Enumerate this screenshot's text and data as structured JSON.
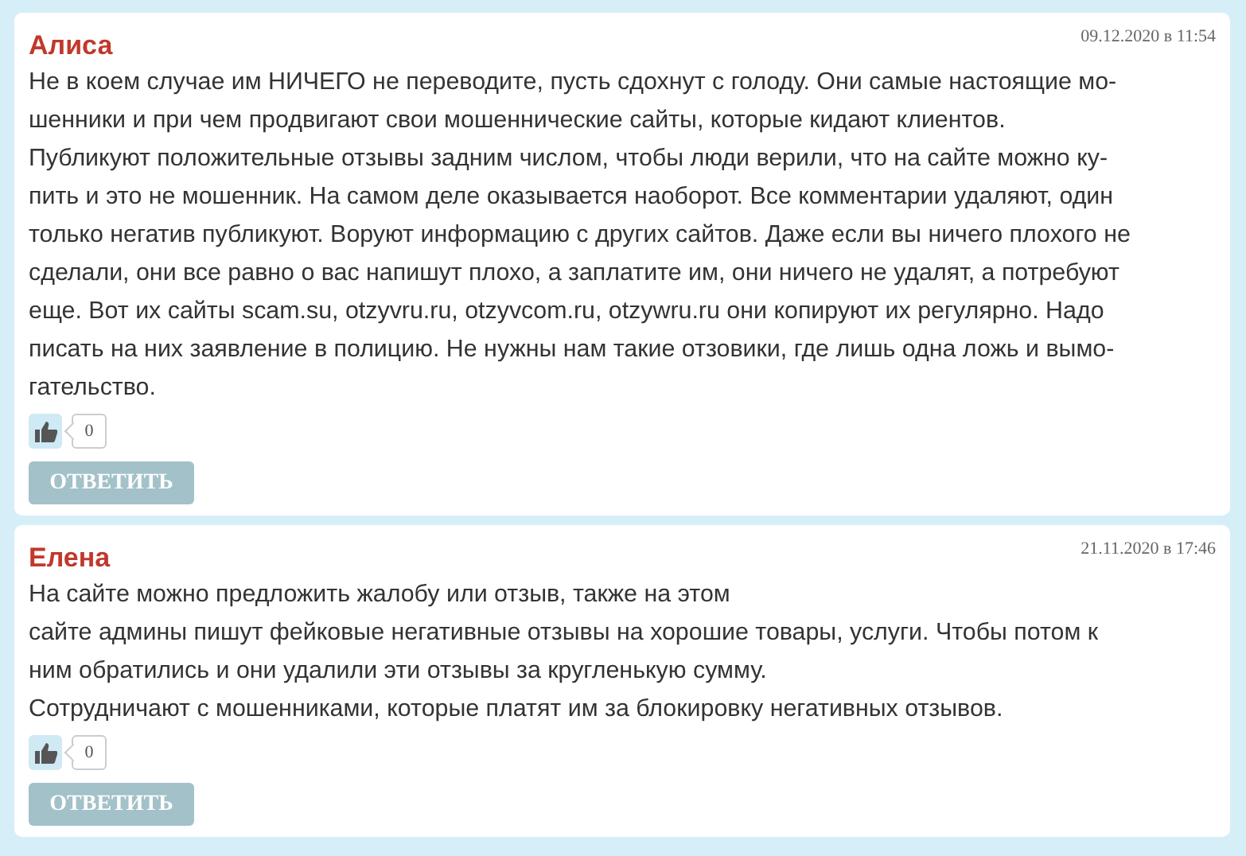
{
  "comments": [
    {
      "author": "Алиса",
      "date": "09.12.2020 в 11:54",
      "text": "Не в коем случае им НИЧЕГО не переводите, пусть сдохнут с голоду. Они самые настоящие мо-\nшенники и при чем продвигают свои мошеннические сайты, которые кидают клиентов.\nПубликуют положительные отзывы задним числом, чтобы люди верили, что на сайте можно ку-\nпить и это не мошенник. На самом деле оказывается наоборот. Все комментарии удаляют, один\nтолько негатив публикуют. Воруют информацию с других сайтов. Даже если вы ничего плохого не\nсделали, они все равно о вас напишут плохо, а заплатите им, они ничего не удалят, а потребуют\nеще. Вот их сайты scam.su, otzyvru.ru, otzyvcom.ru, otzywru.ru они копируют их регулярно. Надо\nписать на них заявление в полицию. Не нужны нам такие отзовики, где лишь одна ложь и вымо-\nгательство.",
      "likes": "0",
      "reply": "ОТВЕТИТЬ"
    },
    {
      "author": "Елена",
      "date": "21.11.2020 в 17:46",
      "text": "На сайте можно предложить жалобу или отзыв, также на этом\nсайте админы пишут фейковые негативные отзывы на хорошие товары, услуги. Чтобы потом к\nним обратились и они удалили эти отзывы за кругленькую сумму.\nСотрудничают с мошенниками, которые платят им за блокировку негативных отзывов.",
      "likes": "0",
      "reply": "ОТВЕТИТЬ"
    }
  ]
}
